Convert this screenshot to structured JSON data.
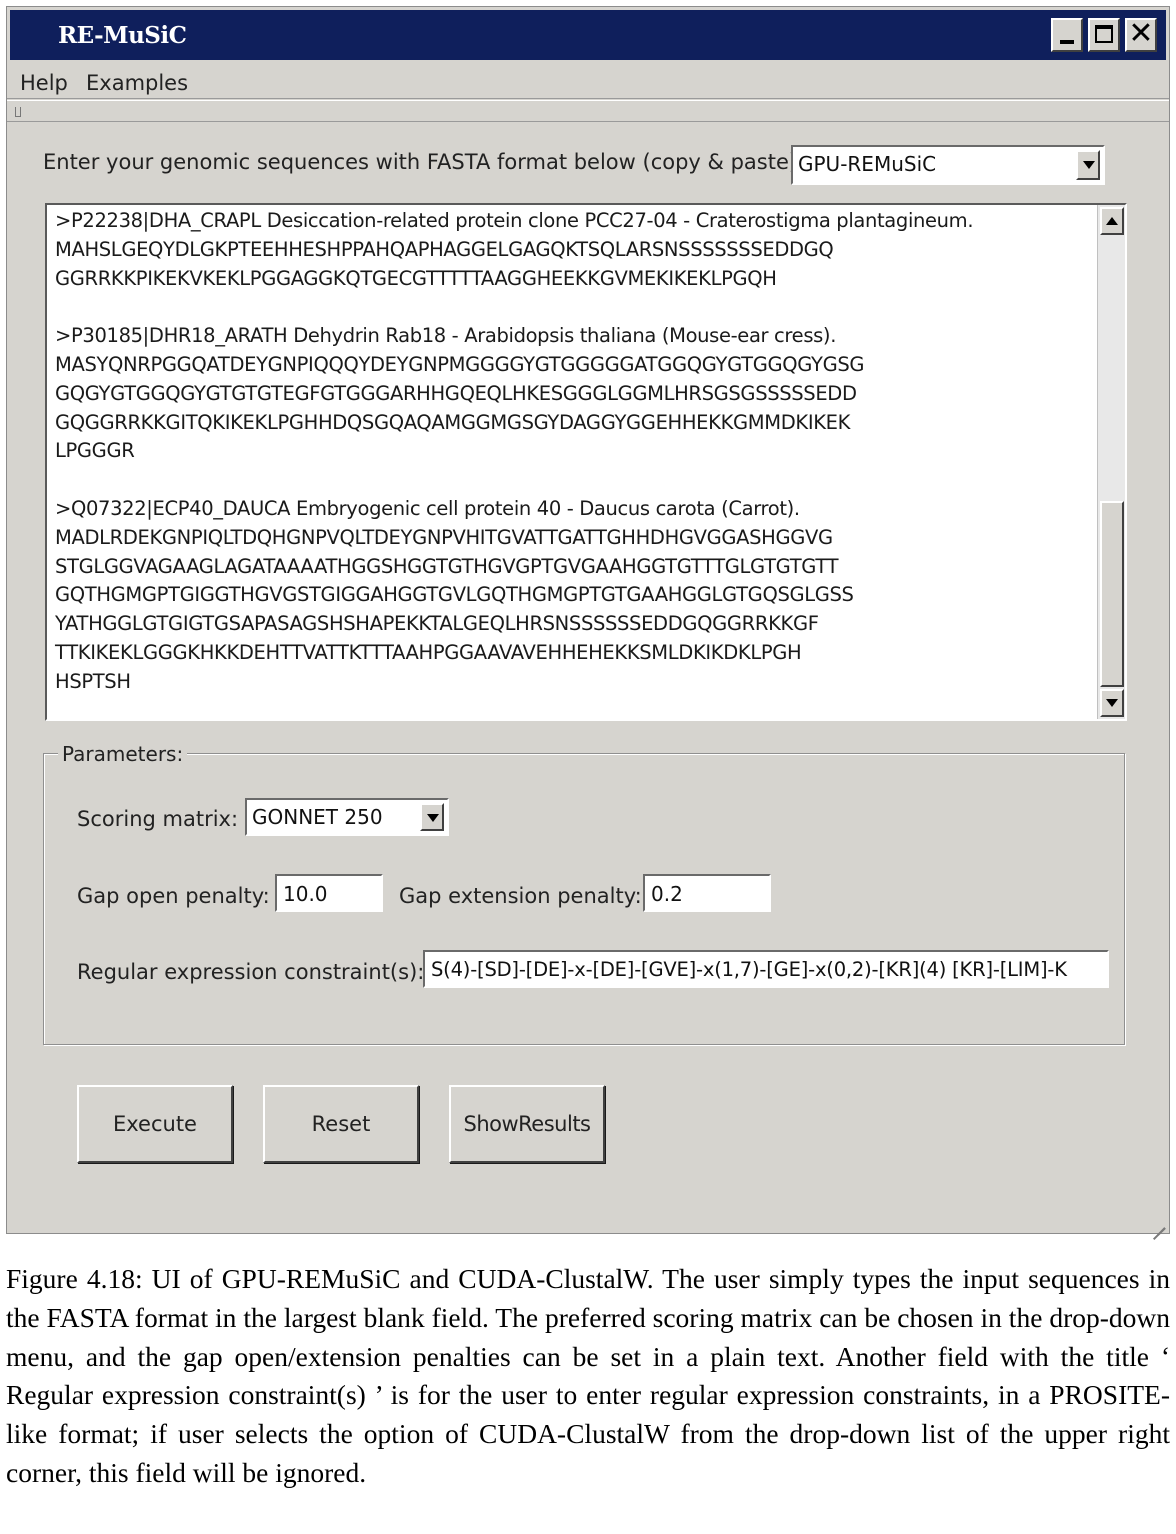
{
  "window": {
    "title": "RE-MuSiC",
    "close_glyph": "✕"
  },
  "menu": {
    "items": [
      "Help",
      "Examples"
    ]
  },
  "input": {
    "prompt": "Enter your genomic sequences with FASTA format below (copy & paste):",
    "algorithm_selected": "GPU-REMuSiC",
    "sequences": ">P22238|DHA_CRAPL Desiccation-related protein clone PCC27-04 - Craterostigma plantagineum.\nMAHSLGEQYDLGKPTEEHHESHPPAHQAPHAGGELGAGQKTSQLARSNSSSSSSSEDDGQ\nGGRRKKPIKEKVKEKLPGGAGGKQTGECGTTTTTAAGGHEEKKGVMEKIKEKLPGQH\n\n>P30185|DHR18_ARATH Dehydrin Rab18 - Arabidopsis thaliana (Mouse-ear cress).\nMASYQNRPGGQATDEYGNPIQQQYDEYGNPMGGGGYGTGGGGGATGGQGYGTGGQGYGSG\nGQGYGTGGQGYGTGTGTEGFGTGGGARHHGQEQLHKESGGGLGGMLHRSGSGSSSSSEDD\nGQGGRRKKGITQKIKEKLPGHHDQSGQAQAMGGMGSGYDAGGYGGEHHEKKGMMDKIKEK\nLPGGGR\n\n>Q07322|ECP40_DAUCA Embryogenic cell protein 40 - Daucus carota (Carrot).\nMADLRDEKGNPIQLTDQHGNPVQLTDEYGNPVHITGVATTGATTGHHDHGVGGASHGGVG\nSTGLGGVAGAAGLAGATAAAATHGGSHGGTGTHGVGPTGVGAAHGGTGTTTGLGTGTGTT\nGQTHGMGPTGIGGTHGVGSTGIGGAHGGTGVLGQTHGMGPTGTGAAHGGLGTGQSGLGSS\nYATHGGLGTGIGTGSAPASAGSHSHAPEKKTALGEQLHRSNSSSSSSEDDGQGGRRKKGF\nTTKIKEKLGGGKHKKDEHTTVATTKTTTAAHPGGAAVAVEHHEHEKKSMLDKIKDKLPGH\nHSPTSH"
  },
  "parameters": {
    "legend": "Parameters:",
    "scoring_matrix_label": "Scoring matrix:",
    "scoring_matrix_value": "GONNET 250",
    "gap_open_label": "Gap open penalty:",
    "gap_open_value": "10.0",
    "gap_extension_label": "Gap extension penalty:",
    "gap_extension_value": "0.2",
    "regex_label": "Regular expression constraint(s):",
    "regex_value": "S(4)-[SD]-[DE]-x-[DE]-[GVE]-x(1,7)-[GE]-x(0,2)-[KR](4) [KR]-[LIM]-K"
  },
  "buttons": {
    "execute": "Execute",
    "reset": "Reset",
    "show_results": "ShowResults"
  },
  "caption": "Figure 4.18: UI of GPU-REMuSiC and CUDA-ClustalW. The user simply types the input sequences in the FASTA format in the largest blank field.  The preferred scoring matrix can be chosen in the drop-down menu, and the gap open/extension penalties can be set in a plain text. Another field with the title ‘ Regular expression constraint(s) ’ is for the user to enter regular expression constraints, in a PROSITE-like format; if user selects the option of CUDA-ClustalW from the drop-down list of the upper right corner, this field will be ignored.",
  "colors": {
    "titlebar": "#0f1f5c",
    "window_bg": "#d6d4cf",
    "field_bg": "#ffffff"
  },
  "icons": [
    "minimize-icon",
    "maximize-icon",
    "close-icon",
    "dropdown-arrow-icon",
    "scroll-up-icon",
    "scroll-down-icon",
    "resize-grip-icon"
  ]
}
